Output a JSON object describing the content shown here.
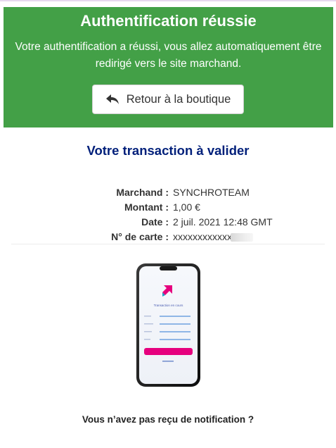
{
  "banner": {
    "title": "Authentification réussie",
    "message": "Votre authentification a réussi, vous allez automatiquement être redirigé vers le site marchand.",
    "return_button_label": "Retour à la boutique",
    "return_icon": "reply-arrow-icon",
    "background_color": "#43a047"
  },
  "transaction": {
    "title": "Votre transaction à valider",
    "rows": [
      {
        "label": "Marchand :",
        "value": "SYNCHROTEAM"
      },
      {
        "label": "Montant :",
        "value": "1,00 €"
      },
      {
        "label": "Date :",
        "value": "2 juil. 2021 12:48 GMT"
      },
      {
        "label": "N° de carte :",
        "value": "xxxxxxxxxxxx"
      }
    ],
    "title_color": "#001f7a"
  },
  "phone_screen": {
    "heading": "Transaction en cours",
    "field_labels": [
      "",
      "",
      "",
      ""
    ],
    "button_label": "",
    "link_label": ""
  },
  "notification": {
    "question": "Vous n’avez pas reçu de notification ?"
  }
}
